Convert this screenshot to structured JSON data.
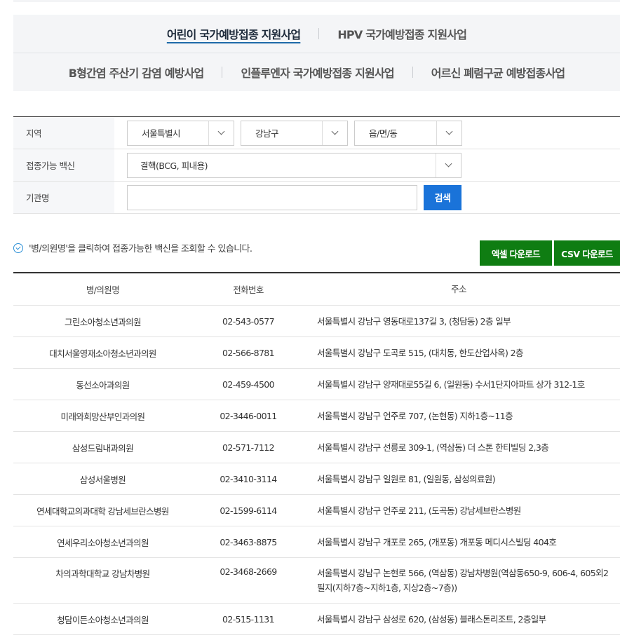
{
  "tabs": {
    "row1": [
      "어린이 국가예방접종 지원사업",
      "HPV 국가예방접종 지원사업"
    ],
    "row2": [
      "B형간염 주산기 감염 예방사업",
      "인플루엔자 국가예방접종 지원사업",
      "어르신 폐렴구균 예방접종사업"
    ]
  },
  "search": {
    "region_label": "지역",
    "region_city": "서울특별시",
    "region_district": "강남구",
    "region_town": "읍/면/동",
    "vaccine_label": "접종가능 백신",
    "vaccine_value": "결핵(BCG, 피내용)",
    "org_label": "기관명",
    "org_value": "",
    "search_button": "검색"
  },
  "notice": "'병/의원명'을 클릭하여 접종가능한 백신을 조회할 수 있습니다.",
  "downloads": {
    "excel": "엑셀 다운로드",
    "csv": "CSV 다운로드"
  },
  "table": {
    "headers": [
      "병/의원명",
      "전화번호",
      "주소"
    ],
    "rows": [
      {
        "name": "그린소아청소년과의원",
        "phone": "02-543-0577",
        "address": "서울특별시 강남구 영동대로137길 3, (청담동) 2층 일부"
      },
      {
        "name": "대치서울영재소아청소년과의원",
        "phone": "02-566-8781",
        "address": "서울특별시 강남구 도곡로 515, (대치동, 한도산업사옥) 2층"
      },
      {
        "name": "동선소아과의원",
        "phone": "02-459-4500",
        "address": "서울특별시 강남구 양재대로55길 6, (일원동) 수서1단지아파트 상가 312-1호"
      },
      {
        "name": "미래와희망산부인과의원",
        "phone": "02-3446-0011",
        "address": "서울특별시 강남구 언주로 707, (논현동) 지하1층~11층"
      },
      {
        "name": "삼성드림내과의원",
        "phone": "02-571-7112",
        "address": "서울특별시 강남구 선릉로 309-1, (역삼동) 더 스톤 한티빌딩 2,3층"
      },
      {
        "name": "삼성서울병원",
        "phone": "02-3410-3114",
        "address": "서울특별시 강남구 일원로 81, (일원동, 삼성의료원)"
      },
      {
        "name": "연세대학교의과대학 강남세브란스병원",
        "phone": "02-1599-6114",
        "address": "서울특별시 강남구 언주로 211, (도곡동) 강남세브란스병원"
      },
      {
        "name": "연세우리소아청소년과의원",
        "phone": "02-3463-8875",
        "address": "서울특별시 강남구 개포로 265, (개포동) 개포동 메디시스빌딩 404호"
      },
      {
        "name": "차의과학대학교 강남차병원",
        "phone": "02-3468-2669",
        "address": "서울특별시 강남구 논현로 566, (역삼동) 강남차병원(역삼동650-9, 606-4, 605외2필지(지하7층~지하1층, 지상2층~7층))"
      },
      {
        "name": "청담이든소아청소년과의원",
        "phone": "02-515-1131",
        "address": "서울특별시 강남구 삼성로 620, (삼성동) 블래스톤리조트, 2층일부"
      }
    ]
  }
}
